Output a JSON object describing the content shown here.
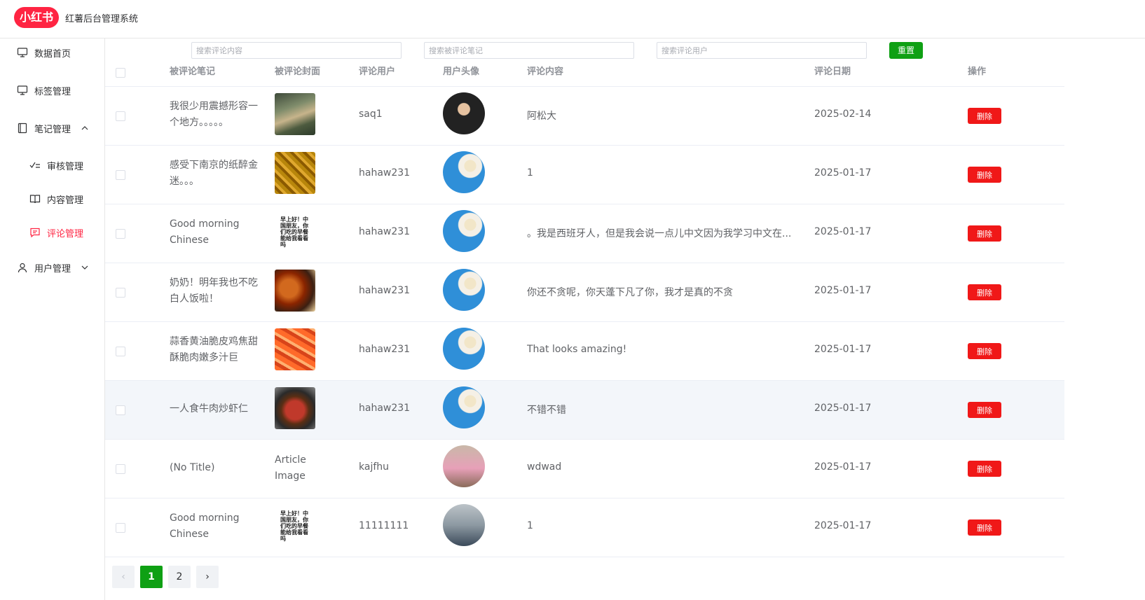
{
  "app": {
    "logo_text": "小红书",
    "title": "红薯后台管理系统"
  },
  "sidebar": {
    "items": [
      {
        "label": "数据首页",
        "icon": "monitor-icon"
      },
      {
        "label": "标签管理",
        "icon": "monitor-icon"
      },
      {
        "label": "笔记管理",
        "icon": "notebook-icon",
        "expanded": true
      },
      {
        "label": "审核管理",
        "icon": "check-list-icon"
      },
      {
        "label": "内容管理",
        "icon": "book-open-icon"
      },
      {
        "label": "评论管理",
        "icon": "comment-icon",
        "active": true
      },
      {
        "label": "用户管理",
        "icon": "user-icon",
        "expanded": false
      }
    ]
  },
  "search": {
    "content_placeholder": "搜索评论内容",
    "note_placeholder": "搜索被评论笔记",
    "user_placeholder": "搜索评论用户",
    "reset_label": "重置"
  },
  "colors": {
    "brand": "#ff2442",
    "active_nav": "#ff2442",
    "reset": "#0fa014",
    "delete": "#f01818",
    "page_active": "#0fa014"
  },
  "table": {
    "headers": {
      "note": "被评论笔记",
      "cover": "被评论封面",
      "user": "评论用户",
      "avatar": "用户头像",
      "content": "评论内容",
      "date": "评论日期",
      "action": "操作"
    },
    "rows": [
      {
        "note": "我很少用震撼形容一个地方。。。。。",
        "user": "saq1",
        "content": "阿松大",
        "date": "2025-02-14",
        "action": "删除"
      },
      {
        "note": "感受下南京的纸醉金迷。。。",
        "user": "hahaw231",
        "content": "1",
        "date": "2025-01-17",
        "action": "删除"
      },
      {
        "note": "Good morning Chinese",
        "cover_text": "早上好！中国朋友，你们吃的早餐能给我看看吗",
        "user": "hahaw231",
        "content": "。我是西班牙人，但是我会说一点儿中文因为我学习中文在...",
        "date": "2025-01-17",
        "action": "删除"
      },
      {
        "note": "奶奶！明年我也不吃白人饭啦！",
        "user": "hahaw231",
        "content": "你还不贪呢，你天蓬下凡了你，我才是真的不贪",
        "date": "2025-01-17",
        "action": "删除"
      },
      {
        "note": "蒜香黄油脆皮鸡焦甜酥脆肉嫩多汁巨",
        "user": "hahaw231",
        "content": "That looks amazing!",
        "date": "2025-01-17",
        "action": "删除"
      },
      {
        "note": "一人食牛肉炒虾仁",
        "user": "hahaw231",
        "content": "不错不错",
        "date": "2025-01-17",
        "action": "删除"
      },
      {
        "note": "(No Title)",
        "cover_alt": "Article Image",
        "user": "kajfhu",
        "content": "wdwad",
        "date": "2025-01-17",
        "action": "删除"
      },
      {
        "note": "Good morning Chinese",
        "cover_text": "早上好！中国朋友，你们吃的早餐能给我看看吗",
        "user": "11111111",
        "content": "1",
        "date": "2025-01-17",
        "action": "删除"
      }
    ]
  },
  "pagination": {
    "prev": "‹",
    "pages": [
      "1",
      "2"
    ],
    "current": "1",
    "next": "›"
  }
}
